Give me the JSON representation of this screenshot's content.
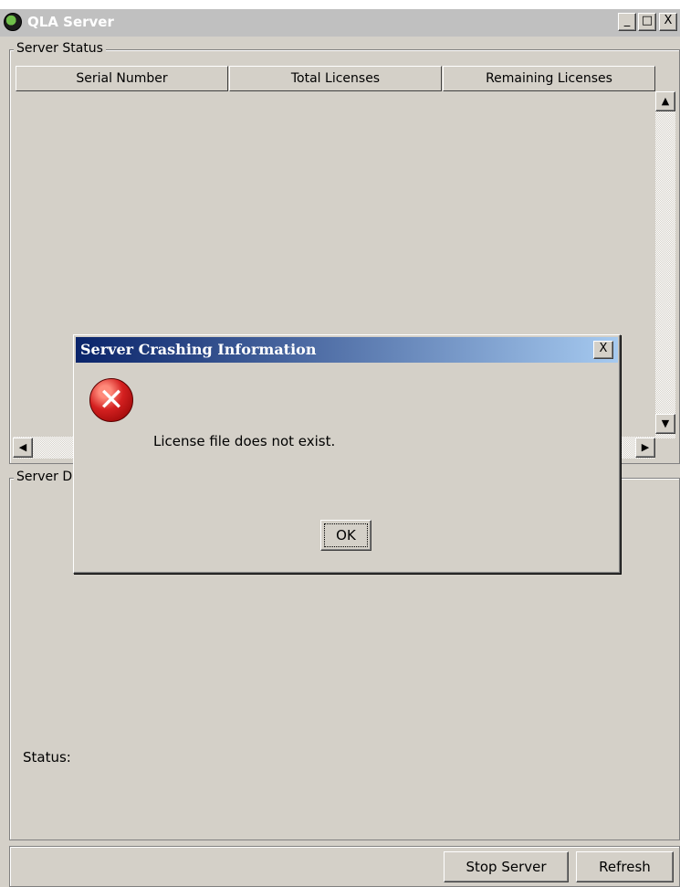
{
  "window": {
    "title": "QLA Server",
    "minimize_label": "_",
    "maximize_label": "□",
    "close_label": "X"
  },
  "server_status": {
    "label": "Server Status",
    "columns": [
      "Serial Number",
      "Total Licenses",
      "Remaining Licenses"
    ]
  },
  "server_details": {
    "label": "Server D",
    "status_label": "Status:"
  },
  "buttons": {
    "stop_server": "Stop Server",
    "refresh": "Refresh"
  },
  "scrollbar": {
    "up": "▲",
    "down": "▼",
    "left": "◀",
    "right": "▶"
  },
  "dialog": {
    "title": "Server Crashing Information",
    "close_label": "X",
    "message": "License file does not exist.",
    "ok_label": "OK",
    "icon": "error-icon"
  }
}
